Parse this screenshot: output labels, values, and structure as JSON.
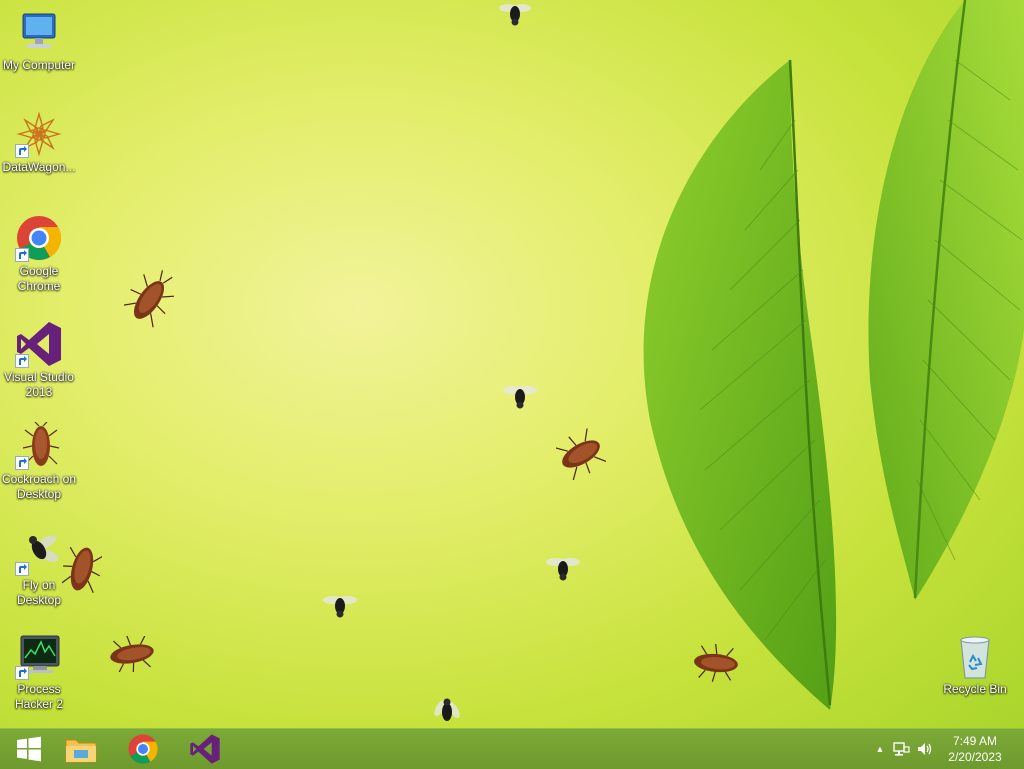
{
  "desktop": {
    "icons": [
      {
        "label": "My Computer",
        "icon": "my-computer-icon"
      },
      {
        "label": "DataWagon...",
        "icon": "datawagon-icon"
      },
      {
        "label": "Google Chrome",
        "icon": "chrome-icon"
      },
      {
        "label": "Visual Studio 2013",
        "icon": "visual-studio-icon"
      },
      {
        "label": "Cockroach on Desktop",
        "icon": "cockroach-icon"
      },
      {
        "label": "Fly on Desktop",
        "icon": "fly-icon"
      },
      {
        "label": "Process Hacker 2",
        "icon": "process-hacker-icon"
      },
      {
        "label": "Recycle Bin",
        "icon": "recycle-bin-icon"
      }
    ]
  },
  "taskbar": {
    "pinned": [
      "start-button",
      "file-explorer",
      "google-chrome",
      "visual-studio"
    ],
    "tray": {
      "show_hidden_glyph": "▲",
      "icons": [
        "network-icon",
        "volume-icon"
      ]
    },
    "clock": {
      "time": "7:49 AM",
      "date": "2/20/2023"
    }
  },
  "colors": {
    "taskbar": "#76a433",
    "accent": "#68217a",
    "chrome_red": "#db4437",
    "chrome_green": "#0f9d58",
    "chrome_yellow": "#f4b400",
    "chrome_blue": "#4285f4"
  }
}
